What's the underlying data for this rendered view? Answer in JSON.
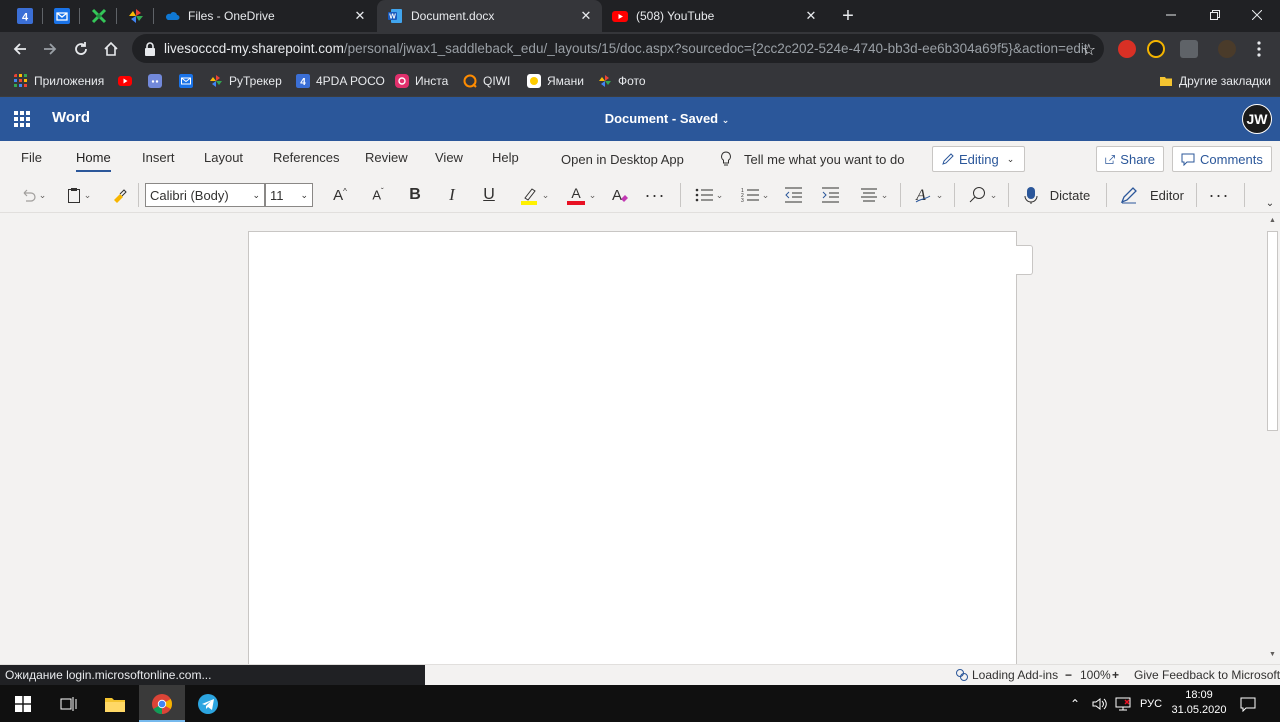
{
  "browser": {
    "pinned_tabs": [
      {
        "icon": "4pda-icon"
      },
      {
        "icon": "mail-icon"
      },
      {
        "icon": "xbox-game-icon"
      },
      {
        "icon": "pinwheel-icon"
      }
    ],
    "tabs": [
      {
        "title": "Files - OneDrive",
        "icon": "onedrive-icon",
        "active": false
      },
      {
        "title": "Document.docx",
        "icon": "word-icon",
        "active": true
      },
      {
        "title": "(508) YouTube",
        "icon": "youtube-icon",
        "active": false
      }
    ],
    "new_tab_label": "+",
    "url_host": "livesocccd-my.sharepoint.com",
    "url_path": "/personal/jwax1_saddleback_edu/_layouts/15/doc.aspx?sourcedoc={2cc2c202-524e-4740-bb3d-ee6b304a69f5}&action=edit",
    "bookmarks": [
      {
        "label": "Приложения",
        "icon": "apps-grid-icon"
      },
      {
        "label": "",
        "icon": "youtube-icon"
      },
      {
        "label": "",
        "icon": "discord-icon"
      },
      {
        "label": "",
        "icon": "mail-icon"
      },
      {
        "label": "РуТрекер",
        "icon": "rutracker-icon"
      },
      {
        "label": "4PDA РОСО",
        "icon": "4pda-icon"
      },
      {
        "label": "Инста",
        "icon": "instagram-icon"
      },
      {
        "label": "QIWI",
        "icon": "qiwi-icon"
      },
      {
        "label": "Ямани",
        "icon": "yamani-icon"
      },
      {
        "label": "Фото",
        "icon": "pinwheel-icon"
      }
    ],
    "other_bookmarks": "Другие закладки",
    "status_loading": "Ожидание login.microsoftonline.com..."
  },
  "word": {
    "app_name": "Word",
    "doc_name": "Document",
    "doc_sep": " - ",
    "doc_status": "Saved",
    "avatar_initials": "JW",
    "menu": [
      "File",
      "Home",
      "Insert",
      "Layout",
      "References",
      "Review",
      "View",
      "Help"
    ],
    "active_menu": "Home",
    "open_desktop": "Open in Desktop App",
    "tell_me": "Tell me what you want to do",
    "editing_label": "Editing",
    "share_label": "Share",
    "comments_label": "Comments",
    "font_name": "Calibri (Body)",
    "font_size": "11",
    "dictate_label": "Dictate",
    "editor_label": "Editor",
    "loading_addins": "Loading Add-ins",
    "zoom": "100%",
    "zoom_minus": "−",
    "zoom_plus": "+",
    "feedback": "Give Feedback to Microsoft"
  },
  "taskbar": {
    "lang": "РУС",
    "time": "18:09",
    "date": "31.05.2020"
  },
  "colors": {
    "word_blue": "#2b579a",
    "chrome_dark": "#202124",
    "chrome_toolbar": "#35363a",
    "highlight_yellow": "#fff100",
    "font_color_red": "#e81123"
  }
}
